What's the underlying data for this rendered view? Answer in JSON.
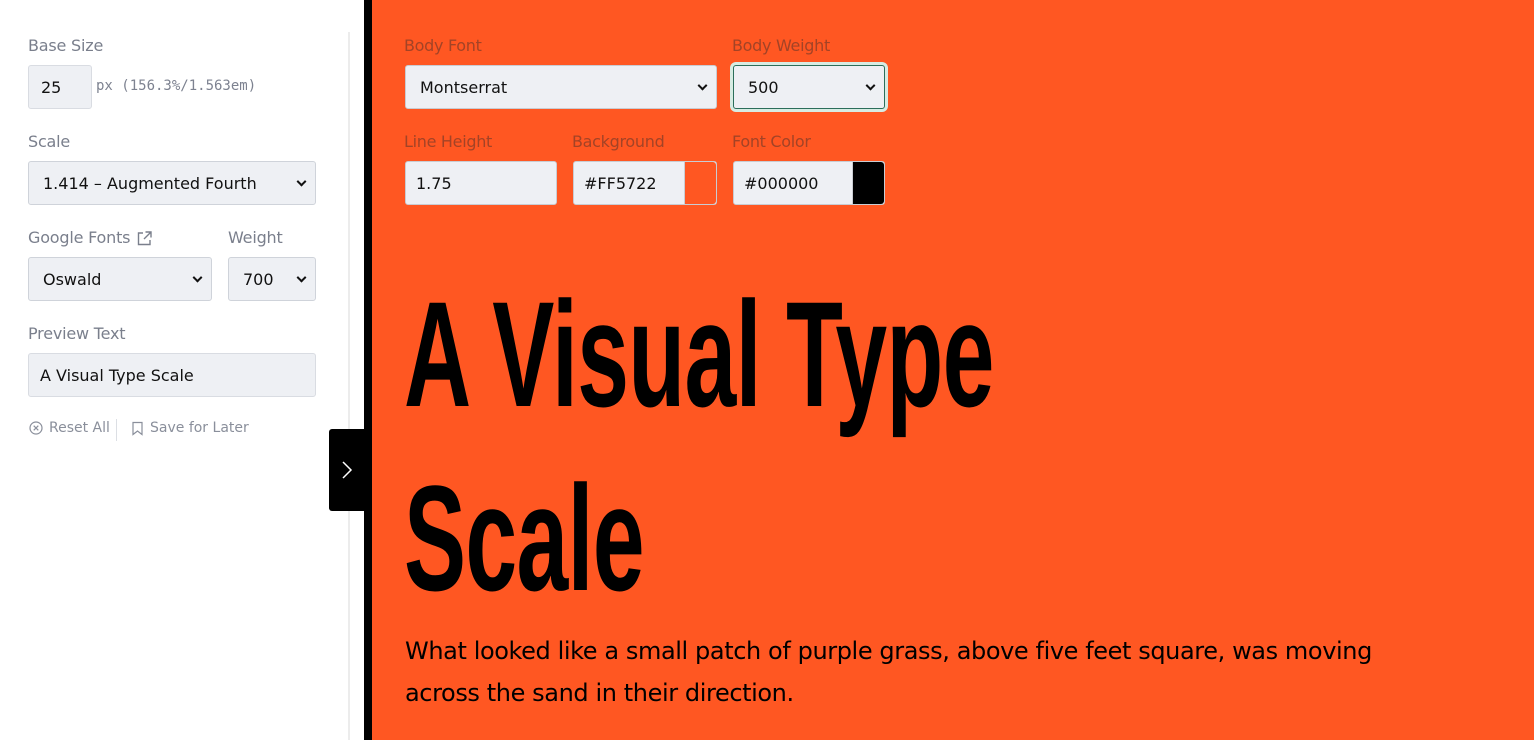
{
  "sidebar": {
    "base_size": {
      "label": "Base Size",
      "value": "25",
      "unit": "px (156.3%/1.563em)"
    },
    "scale": {
      "label": "Scale",
      "selected": "1.414 – Augmented Fourth"
    },
    "google_fonts": {
      "label": "Google Fonts",
      "selected": "Oswald"
    },
    "weight": {
      "label": "Weight",
      "selected": "700"
    },
    "preview_text": {
      "label": "Preview Text",
      "value": "A Visual Type Scale"
    },
    "actions": {
      "reset": "Reset All",
      "save": "Save for Later"
    }
  },
  "controls": {
    "body_font": {
      "label": "Body Font",
      "selected": "Montserrat"
    },
    "body_weight": {
      "label": "Body Weight",
      "selected": "500"
    },
    "line_height": {
      "label": "Line Height",
      "value": "1.75"
    },
    "background": {
      "label": "Background",
      "value": "#FF5722",
      "swatch": "#FF5722"
    },
    "font_color": {
      "label": "Font Color",
      "value": "#000000",
      "swatch": "#000000"
    }
  },
  "preview": {
    "headline_line1": "A Visual Type",
    "headline_line2": "Scale",
    "body": "What looked like a small patch of purple grass, above five feet square, was moving across the sand in their direction."
  },
  "icons": {
    "external_link": "external-link-icon",
    "reset": "x-circle-icon",
    "save": "bookmark-icon",
    "toggle": "chevron-right-icon"
  }
}
